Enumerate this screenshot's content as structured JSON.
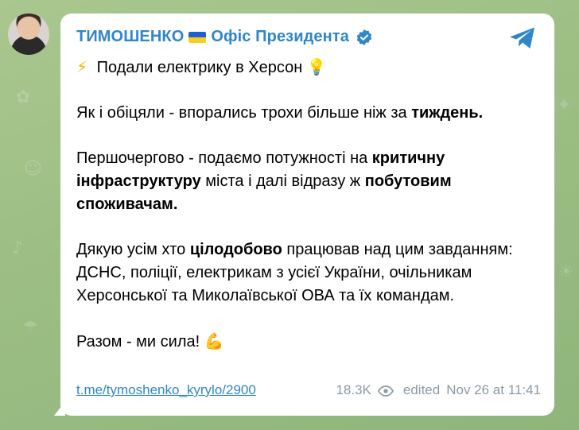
{
  "post": {
    "channel_name": "ТИМОШЕНКО",
    "channel_suffix": "Офіс Президента",
    "title": "Подали електрику в Херсон",
    "title_icon_left": "⚡",
    "title_icon_right": "💡",
    "p1_a": "Як і обіцяли - впорались трохи більше ніж за ",
    "p1_b": "тиждень.",
    "p2_a": "Першочергово - подаємо потужності на ",
    "p2_b": "критичну інфраструктуру",
    "p2_c": " міста і далі відразу ж ",
    "p2_d": "побутовим споживачам.",
    "p3_a": "Дякую усім хто ",
    "p3_b": "цілодобово",
    "p3_c": " працював над цим завданням: ДСНС, поліції, електрикам з усієї України, очільникам Херсонської та Миколаївської ОВА та їх командам.",
    "p4": "Разом - ми сила!",
    "p4_emoji": "💪",
    "link": "t.me/tymoshenko_kyrylo/2900",
    "views": "18.3K",
    "edited": "edited",
    "timestamp": "Nov 26 at 11:41"
  },
  "icons": {
    "verified": "verified-badge-icon",
    "share": "telegram-share-icon",
    "views": "eye-icon",
    "flag": "ukraine-flag-icon"
  },
  "colors": {
    "accent": "#2f86c9",
    "meta": "#8a9aa6",
    "background": "#9dbf86",
    "flag_blue": "#1f5fd1",
    "flag_yellow": "#f7cf1d"
  }
}
